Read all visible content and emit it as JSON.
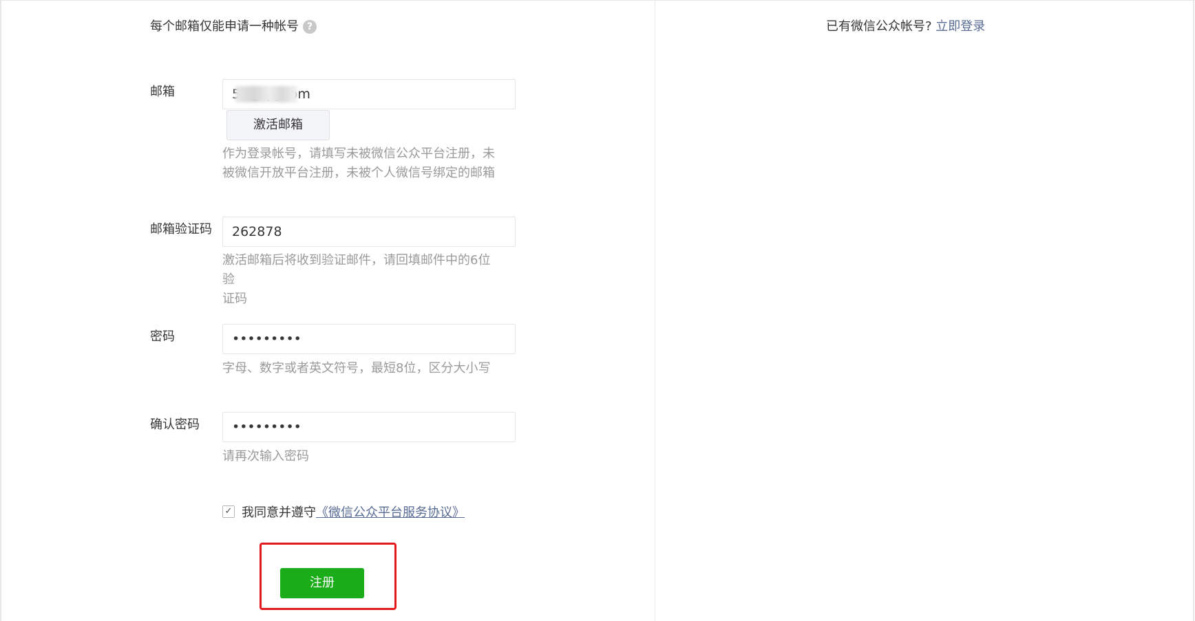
{
  "header": {
    "notice": "每个邮箱仅能申请一种帐号",
    "help_icon": "question-circle-icon",
    "login_prompt": "已有微信公众帐号?",
    "login_link": "立即登录"
  },
  "form": {
    "email": {
      "label": "邮箱",
      "value": "59@qq.com",
      "activate_button": "激活邮箱",
      "hint_line1": "作为登录帐号，请填写未被微信公众平台注册，未",
      "hint_line2": "被微信开放平台注册，未被个人微信号绑定的邮箱"
    },
    "verify_code": {
      "label": "邮箱验证码",
      "value": "262878",
      "hint_line1": "激活邮箱后将收到验证邮件，请回填邮件中的6位验",
      "hint_line2": "证码"
    },
    "password": {
      "label": "密码",
      "value": "•••••••••",
      "hint": "字母、数字或者英文符号，最短8位，区分大小写"
    },
    "confirm_password": {
      "label": "确认密码",
      "value": "•••••••••",
      "hint": "请再次输入密码"
    },
    "agreement": {
      "checked": true,
      "text": "我同意并遵守",
      "link": "《微信公众平台服务协议》"
    },
    "submit_label": "注册"
  },
  "colors": {
    "link": "#576b95",
    "primary_button": "#1aad19",
    "highlight": "#e5191c",
    "hint_text": "#9a9a9a"
  }
}
